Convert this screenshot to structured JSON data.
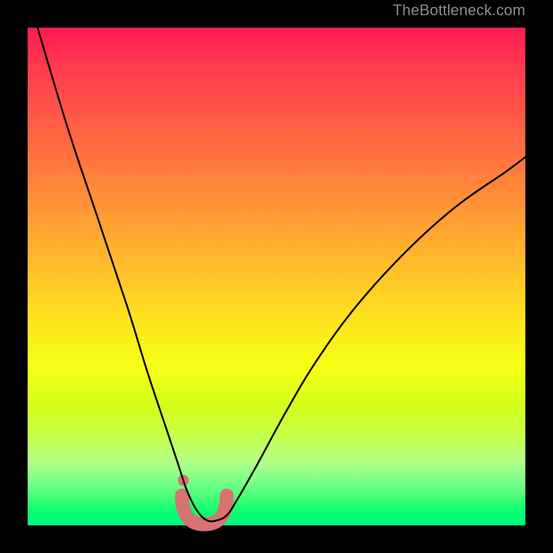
{
  "watermark": "TheBottleneck.com",
  "colors": {
    "page_bg": "#000000",
    "watermark_text": "#8c8c8c",
    "curve_stroke": "#000000",
    "valley_marker": "#d67373",
    "gradient_top": "#ff1a54",
    "gradient_bottom": "#00ff78"
  },
  "chart_data": {
    "type": "line",
    "title": "",
    "xlabel": "",
    "ylabel": "",
    "xlim": [
      0,
      100
    ],
    "ylim": [
      0,
      100
    ],
    "grid": false,
    "legend": false,
    "series": [
      {
        "name": "bottleneck-curve",
        "x": [
          2,
          8,
          14,
          20,
          24,
          28,
          30,
          32,
          34,
          36,
          38,
          40,
          42,
          46,
          52,
          58,
          66,
          76,
          86,
          96,
          100
        ],
        "values": [
          100,
          80,
          62,
          44,
          31,
          19,
          13,
          7,
          3,
          1,
          1,
          2,
          5,
          12,
          23,
          33,
          44,
          55,
          64,
          71,
          74
        ]
      }
    ],
    "annotations": [
      {
        "name": "valley-highlight",
        "shape": "round-valley",
        "x_range": [
          31,
          40
        ],
        "y_range": [
          0.2,
          6
        ]
      }
    ]
  }
}
